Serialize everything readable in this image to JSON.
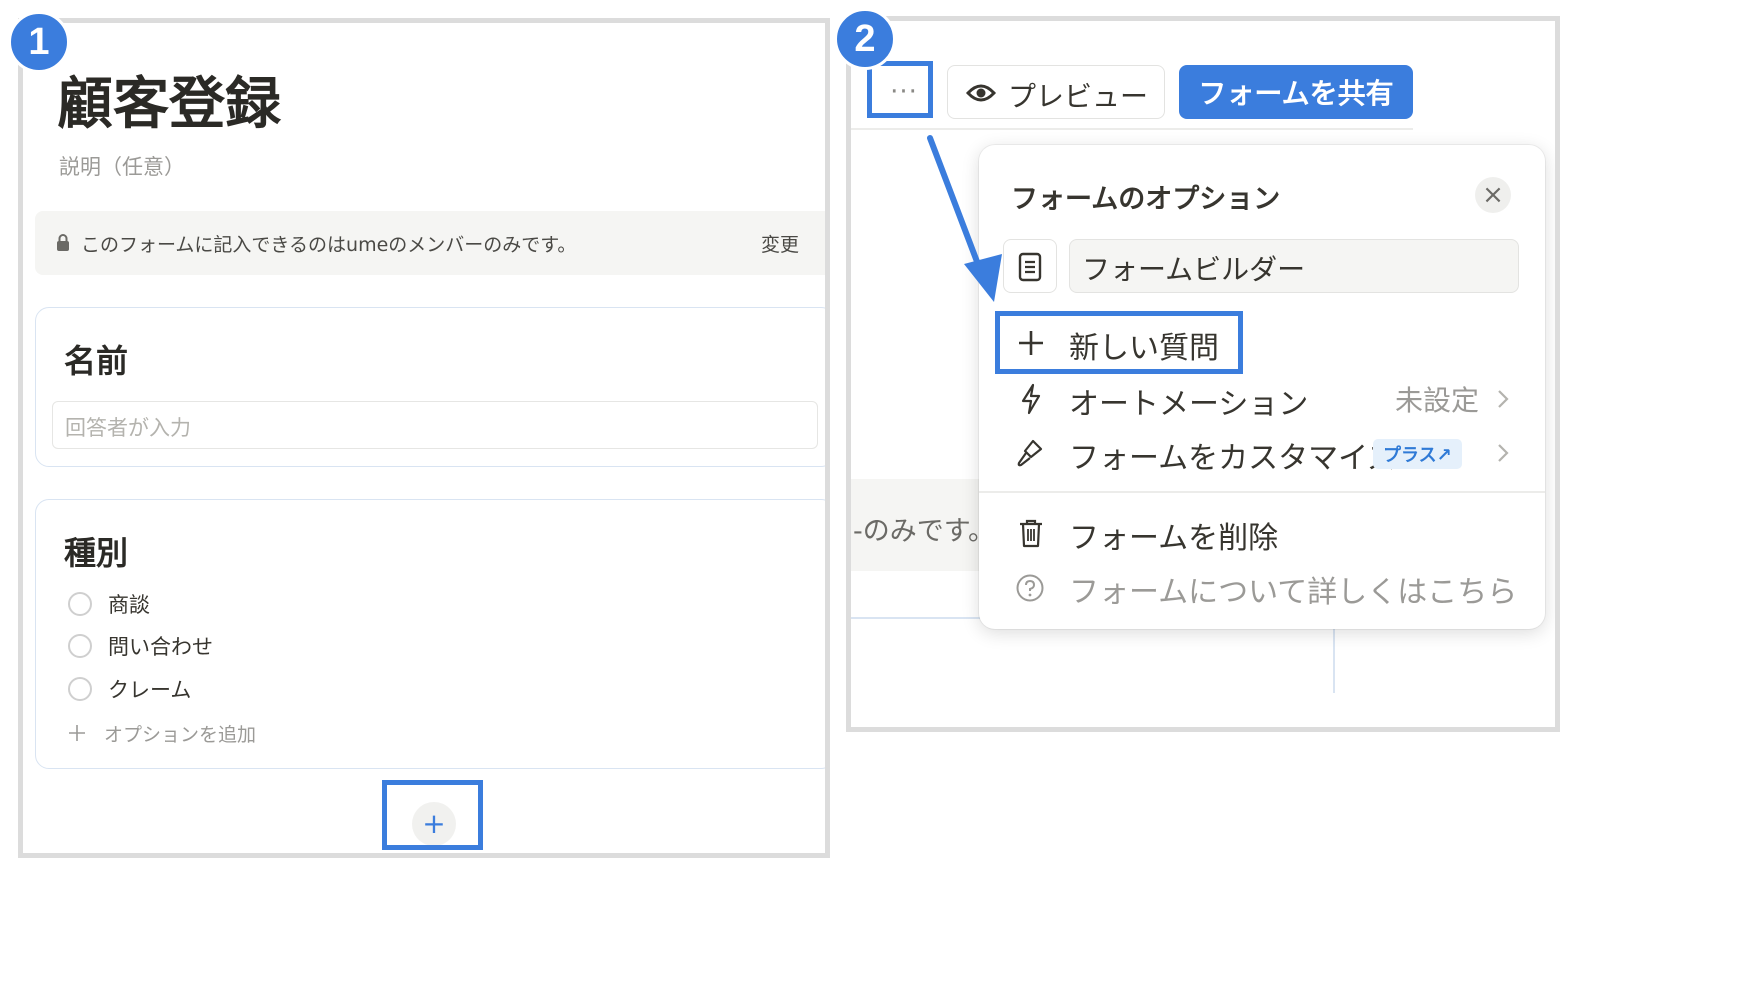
{
  "panel1": {
    "badge": "1",
    "title": "顧客登録",
    "description": "説明（任意）",
    "access_notice": "このフォームに記入できるのはumeのメンバーのみです。",
    "change_link": "変更",
    "question1": {
      "title": "名前",
      "placeholder": "回答者が入力"
    },
    "question2": {
      "title": "種別",
      "options": [
        "商談",
        "問い合わせ",
        "クレーム"
      ],
      "add_option": "オプションを追加"
    },
    "add_question_symbol": "+"
  },
  "panel2": {
    "badge": "2",
    "toolbar": {
      "more_symbol": "···",
      "preview_label": "プレビュー",
      "share_label": "フォームを共有"
    },
    "background_text": "-のみです。",
    "popover": {
      "title": "フォームのオプション",
      "close_symbol": "×",
      "form_name": "フォームビルダー",
      "items": {
        "new_question": "新しい質問",
        "automation": "オートメーション",
        "automation_status": "未設定",
        "customize": "フォームをカスタマイズ",
        "plus_badge": "プラス↗",
        "delete": "フォームを削除",
        "learn_more": "フォームについて詳しくはこちら"
      }
    }
  },
  "colors": {
    "accent": "#3b7ddd",
    "panel_border": "#dcdcdc",
    "text": "#37352f",
    "muted": "#9b9a97"
  }
}
